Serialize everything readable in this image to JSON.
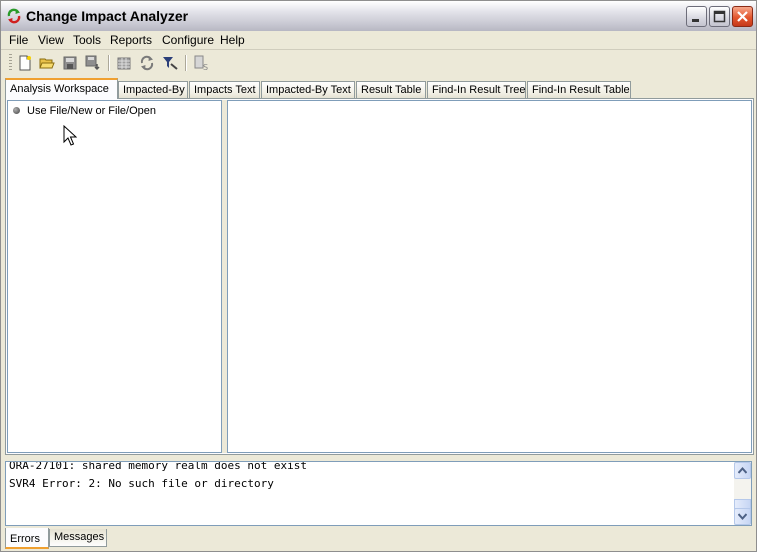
{
  "window": {
    "title": "Change Impact Analyzer"
  },
  "menu": {
    "items": [
      "File",
      "View",
      "Tools",
      "Reports",
      "Configure",
      "Help"
    ]
  },
  "toolbar": {
    "buttons": [
      "new-file-icon",
      "open-folder-icon",
      "save-icon",
      "save-as-icon",
      "grid-icon",
      "refresh-icon",
      "filter-icon",
      "report-icon"
    ]
  },
  "tabs": {
    "items": [
      "Analysis Workspace",
      "Impacted-By",
      "Impacts Text",
      "Impacted-By Text",
      "Result Table",
      "Find-In Result Tree",
      "Find-In Result Table"
    ],
    "active": "Analysis Workspace"
  },
  "tree": {
    "root_label": "Use File/New or File/Open"
  },
  "log": {
    "lines": [
      "ORA-27101: shared memory realm does not exist",
      "SVR4 Error: 2: No such file or directory"
    ]
  },
  "bottom_tabs": {
    "items": [
      "Errors",
      "Messages"
    ],
    "active": "Errors"
  },
  "colors": {
    "tab_accent": "#f0a030",
    "pane_border": "#7f9db9",
    "window_bg": "#ece9d8"
  }
}
